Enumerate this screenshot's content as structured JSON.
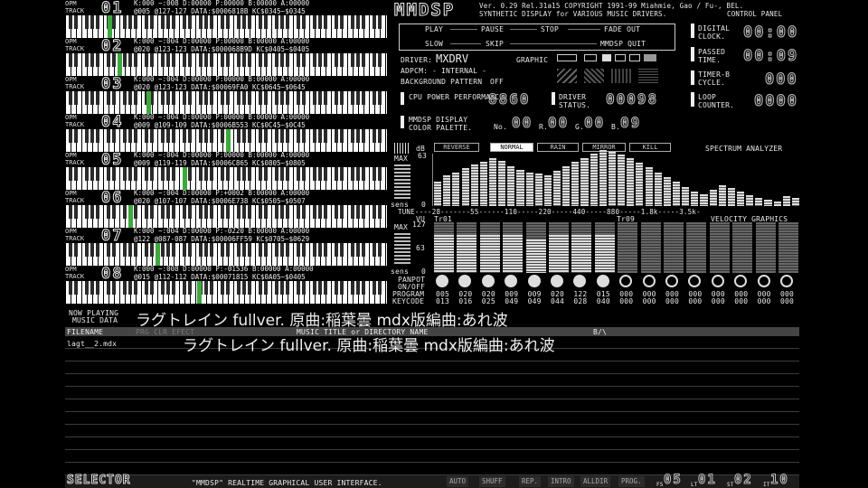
{
  "tracks": [
    {
      "num": "01",
      "info1": "K:000 ~:008 D:00000 P:00000 B:00000 A:00000",
      "info2": "@005 @127-127 DATA:$0006818B KC$0345~$0345",
      "mark": 47
    },
    {
      "num": "02",
      "info1": "K:000 ~:004 D:00000 P:00000 B:00000 A:00000",
      "info2": "@020 @123-123 DATA:$000068B9D KC$0405~$0405",
      "mark": 58
    },
    {
      "num": "03",
      "info1": "K:000 ~:004 D:00000 P:00000 B:00000 A:00000",
      "info2": "@020 @123-123 DATA:$00069FA0 KC$0645~$0645",
      "mark": 90
    },
    {
      "num": "04",
      "info1": "K:000 ~:004 D:00000 P:00000 B:00000 A:00000",
      "info2": "@009 @109-109 DATA:$0006B553 KC$0C45~$0C45",
      "mark": 178
    },
    {
      "num": "05",
      "info1": "K:000 ~:004 D:00000 P:00000 B:00000 A:00000",
      "info2": "@009 @119-119 DATA:$0006C865 KC$0805~$0805",
      "mark": 130
    },
    {
      "num": "06",
      "info1": "K:000 ~:004 D:00000 P:+0002 B:00000 A:00000",
      "info2": "@020 @107-107 DATA:$0006E738 KC$0505~$0507",
      "mark": 70
    },
    {
      "num": "07",
      "info1": "K:000 ~:004 D:00000 P:-0220 B:00000 A:00000",
      "info2": "@122 @087-087 DATA:$00006FF59 KC$0705~$0629",
      "mark": 100
    },
    {
      "num": "08",
      "info1": "K:000 ~:008 D:00000 P:-01536 B:00000 A:00000",
      "info2": "@015 @112-112 DATA:$00071815 KC$0A05~$0405",
      "mark": 146
    }
  ],
  "track_label_top": "OPM",
  "track_label_bottom": "TRACK",
  "header": {
    "logo": "MMDSP",
    "version": "Ver. 0.29 Rel.31a15 COPYRIGHT 1991-99 Miahmie, Gao / Fu-, BEL.",
    "subtitle": "SYNTHETIC DISPLAY for VARIOUS MUSIC DRIVERS.",
    "control_panel": "CONTROL PANEL"
  },
  "controls": {
    "play": "PLAY",
    "pause": "PAUSE",
    "stop": "STOP",
    "fadeout": "FADE OUT",
    "slow": "SLOW",
    "skip": "SKIP",
    "quit": "MMDSP QUIT"
  },
  "driver": {
    "driver_label": "DRIVER:",
    "driver_value": "MXDRV",
    "adpcm_label": "ADPCM:",
    "adpcm_value": "- INTERNAL -",
    "bg_label": "BACKGROUND PATTERN",
    "bg_value": "OFF",
    "graphic_label": "GRAPHIC"
  },
  "clocks": {
    "digital_label": "DIGITAL CLOCK.",
    "digital_value": "00:00",
    "passed_label": "PASSED TIME.",
    "passed_value": "00:09",
    "timer_label": "TIMER-B CYCLE.",
    "timer_value": "000",
    "loop_label": "LOOP COUNTER.",
    "loop_value": "0000"
  },
  "perf": {
    "cpu_label": "CPU POWER PERFORMANCE.",
    "cpu_value": "8860",
    "drv_label": "DRIVER STATUS.",
    "drv_value": "00098"
  },
  "palette": {
    "label": "MMDSP DISPLAY COLOR PALETTE.",
    "no": "00",
    "r": "00",
    "g": "00",
    "b": "09"
  },
  "spectrum": {
    "tabs": [
      "REVERSE",
      "NORMAL",
      "RAIN",
      "MIRROR",
      "KILL"
    ],
    "active_tab": "NORMAL",
    "title": "SPECTRUM ANALYZER",
    "db_label": "dB",
    "max_label": "MAX",
    "max_value": "63",
    "sens_label": "sens",
    "sens_value": "0",
    "tune_axis": "TUNE----28-------55------110-----220-----440-----880-----1.8k-----3.5k-",
    "levels": [
      30,
      38,
      42,
      47,
      52,
      55,
      60,
      56,
      50,
      45,
      42,
      40,
      38,
      44,
      50,
      55,
      60,
      65,
      70,
      68,
      64,
      60,
      54,
      48,
      42,
      36,
      30,
      24,
      18,
      15,
      20,
      26,
      22,
      18,
      14,
      10,
      8,
      6,
      12,
      10
    ]
  },
  "velocity": {
    "title": "VELOCITY GRAPHICS",
    "vu_label": "VU",
    "tr01": "Tr01",
    "tr09": "Tr09",
    "max_label": "MAX",
    "max_value": "127",
    "mid_value": "63",
    "sens_label": "sens",
    "sens_value": "0",
    "levels": [
      95,
      95,
      95,
      95,
      85,
      95,
      95,
      95,
      0,
      0,
      0,
      0,
      0,
      0,
      0,
      0
    ]
  },
  "mixer": {
    "panpot": "PANPOT",
    "onoff": "ON/OFF",
    "program": "PROGRAM",
    "keycode": "KEYCODE",
    "programs": [
      "005",
      "020",
      "020",
      "009",
      "009",
      "020",
      "122",
      "015",
      "000",
      "000",
      "000",
      "000",
      "000",
      "000",
      "000",
      "000"
    ],
    "keycodes": [
      "013",
      "016",
      "025",
      "049",
      "049",
      "044",
      "028",
      "040",
      "000",
      "000",
      "000",
      "000",
      "000",
      "000",
      "000",
      "000"
    ]
  },
  "now_playing": {
    "label1": "NOW PLAYING",
    "label2": "MUSIC DATA",
    "title": "ラグトレイン fullver. 原曲:稲葉曇 mdx版編曲:あれ波"
  },
  "selector": {
    "col_filename": "FILENAME",
    "col_prg": "PRG CLR EFECT",
    "col_title": "MUSIC TITLE or DIRECTORY NAME",
    "col_size": "B/\\",
    "files": [
      {
        "filename": "lagt__2.mdx",
        "title": "ラグトレイン fullver. 原曲:稲葉曇 mdx版編曲:あれ波"
      }
    ],
    "logo": "SELECTOR",
    "caption": "\"MMDSP\" REALTIME GRAPHICAL USER INTERFACE.",
    "buttons": [
      "AUTO",
      "SHUFF",
      "REP.",
      "INTRO",
      "ALLDIR",
      "PROG."
    ],
    "fs_label": "FS",
    "fs_value": "05",
    "lt_label": "LT",
    "lt_value": "01",
    "st_label": "ST",
    "st_value": "02",
    "it_label": "IT",
    "it_value": "10"
  }
}
